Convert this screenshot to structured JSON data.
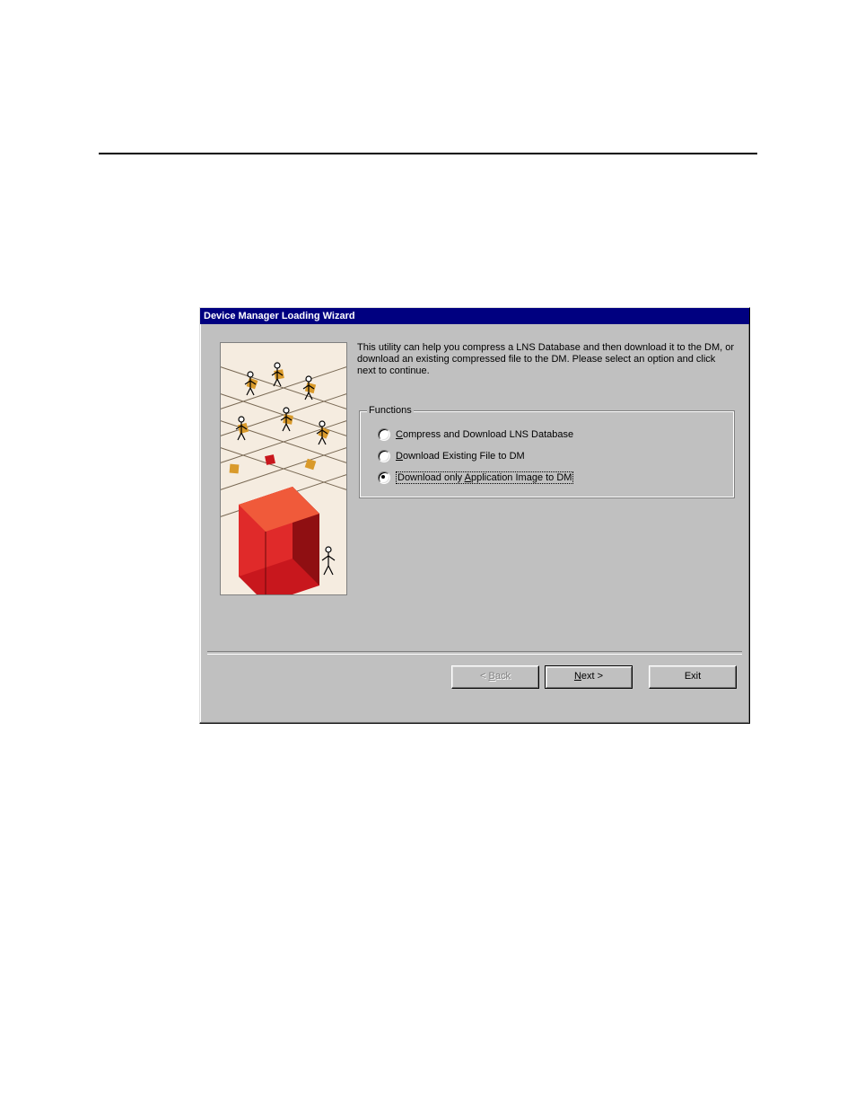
{
  "dialog": {
    "title": "Device Manager Loading Wizard",
    "intro": "This utility can help you compress a LNS Database and then download it to the DM, or download an existing compressed file to the DM. Please select an option and click next to continue.",
    "fieldset_label": "Functions",
    "options": [
      {
        "label_pre": "",
        "mnemonic": "C",
        "label_post": "ompress and Download LNS Database",
        "selected": false
      },
      {
        "label_pre": "",
        "mnemonic": "D",
        "label_post": "ownload Existing File to DM",
        "selected": false
      },
      {
        "label_pre": "Download only ",
        "mnemonic": "A",
        "label_post": "pplication Image to DM",
        "selected": true
      }
    ],
    "buttons": {
      "back_pre": "< ",
      "back_mnemonic": "B",
      "back_post": "ack",
      "next_mnemonic": "N",
      "next_post": "ext >",
      "exit": "Exit"
    }
  }
}
